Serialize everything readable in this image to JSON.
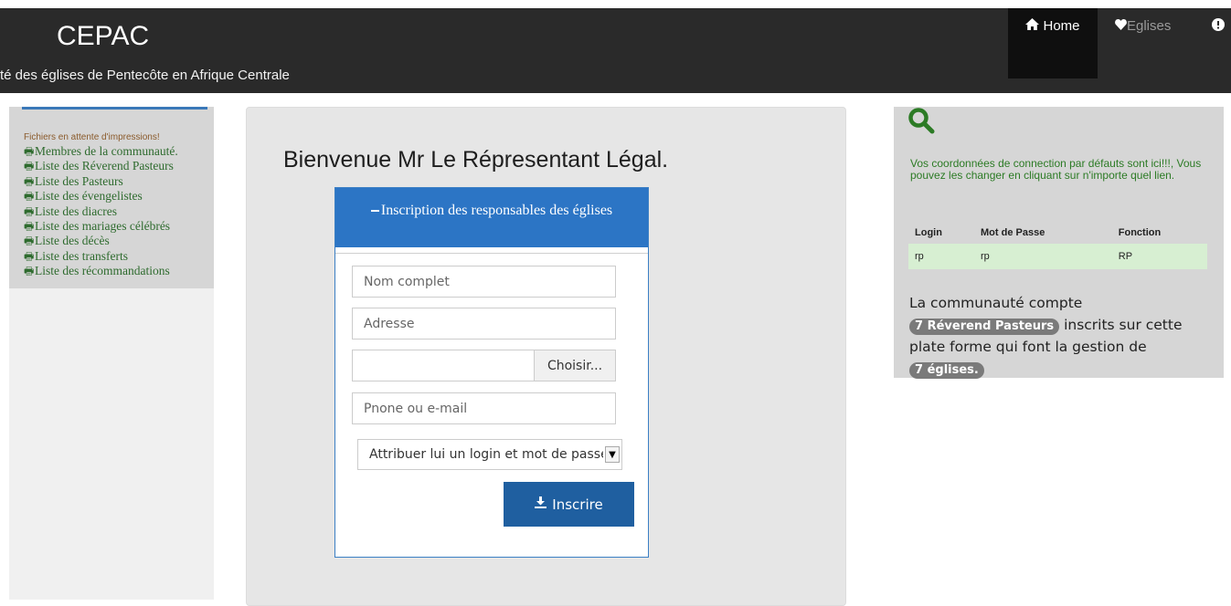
{
  "header": {
    "brand": "CEPAC",
    "subtitle": "té des églises de Pentecôte en Afrique Centrale"
  },
  "nav": {
    "home": "Home",
    "eglises": "Eglises",
    "home_icon": "home-icon",
    "eglises_icon": "heart-icon",
    "info_icon": "exclamation-circle-icon"
  },
  "sidebar": {
    "note": "Fichiers en attente d'impressions!",
    "items": [
      "Membres de la communauté.",
      "Liste des Réverend Pasteurs",
      "Liste des Pasteurs",
      "Liste des évengelistes",
      "Liste des diacres",
      "Liste des mariages célébrés",
      "Liste des décès",
      "Liste des transferts",
      "Liste des récommandations"
    ],
    "item_icon": "print-icon"
  },
  "main": {
    "welcome": "Bienvenue Mr Le Répresentant Légal.",
    "form": {
      "title": "Inscription des responsables des églises",
      "name_placeholder": "Nom complet",
      "address_placeholder": "Adresse",
      "file_button": "Choisir...",
      "contact_placeholder": "Pnone ou e-mail",
      "select_value": "Attribuer lui un login et mot de passe",
      "submit": "Inscrire"
    }
  },
  "right": {
    "note": "Vos coordonnées de connection par défauts sont ici!!!, Vous pouvez les changer en cliquant sur n'importe quel lien.",
    "table": {
      "headers": [
        "Login",
        "Mot de Passe",
        "Fonction"
      ],
      "rows": [
        [
          "rp",
          "rp",
          "RP"
        ]
      ]
    },
    "stats": {
      "prefix": "La communauté compte",
      "badge1": "7 Réverend Pasteurs",
      "middle": " inscrits sur cette plate forme qui font la gestion de",
      "badge2": "7 églises."
    }
  },
  "colors": {
    "topbar": "#2a2a2a",
    "form_header": "#2c75c5",
    "submit": "#1f5fa0",
    "accent_green": "#2c7b25"
  }
}
